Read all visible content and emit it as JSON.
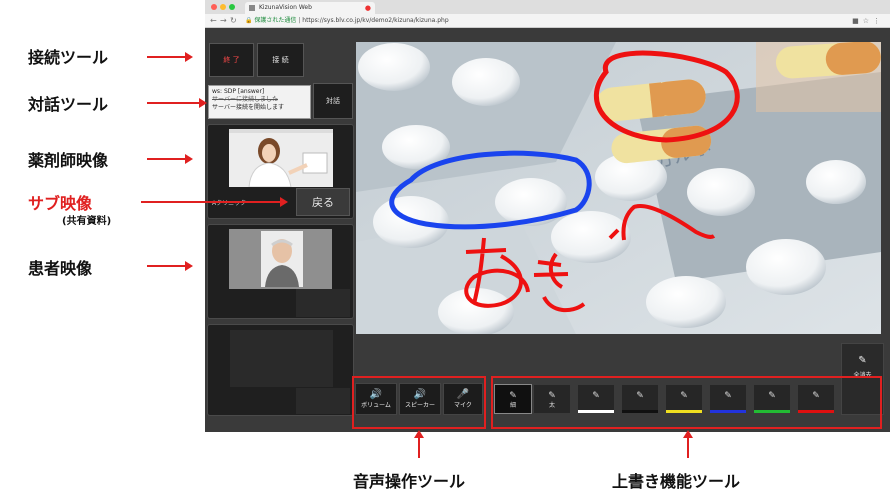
{
  "browser": {
    "tab_title": "KizunaVision Web",
    "secure_label": "保護された通信",
    "url": "https://sys.blv.co.jp/kv/demo2/kizuna/kizuna.php",
    "traffic_lights": [
      "#ff5f57",
      "#febc2e",
      "#28c840"
    ]
  },
  "left_panel": {
    "end_button": "終 了",
    "connect_button": "接 続",
    "log_lines": [
      "ws: SDP [answer]",
      "サーバーに接続しました",
      "サーバー接続を開始します"
    ],
    "dialog_button": "対話",
    "sub_video_label": "Aクリニック",
    "back_button": "戻る"
  },
  "media_tools": {
    "volume": "ボリューム",
    "speaker": "スピーカー",
    "mic": "マイク"
  },
  "pen_tools": [
    {
      "label": "細",
      "color": "#262626",
      "active": true
    },
    {
      "label": "太",
      "color": "#262626",
      "active": false
    },
    {
      "label": "",
      "color": "#ffffff",
      "active": false
    },
    {
      "label": "",
      "color": "#1a1a1a",
      "active": false
    },
    {
      "label": "",
      "color": "#f0e020",
      "active": false
    },
    {
      "label": "",
      "color": "#2233dd",
      "active": false
    },
    {
      "label": "",
      "color": "#22bb33",
      "active": false
    },
    {
      "label": "",
      "color": "#e01010",
      "active": false
    }
  ],
  "clear_all": "全消去",
  "annotations": {
    "connect_tools": "接続ツール",
    "dialog_tools": "対話ツール",
    "pharmacist_video": "薬剤師映像",
    "sub_video": "サブ映像",
    "sub_video_note": "(共有資料)",
    "patient_video": "患者映像",
    "audio_tools": "音声操作ツール",
    "overwrite_tools": "上書き機能ツール"
  },
  "colors": {
    "accent_red": "#e02020",
    "end_text": "#ff4a4a"
  }
}
